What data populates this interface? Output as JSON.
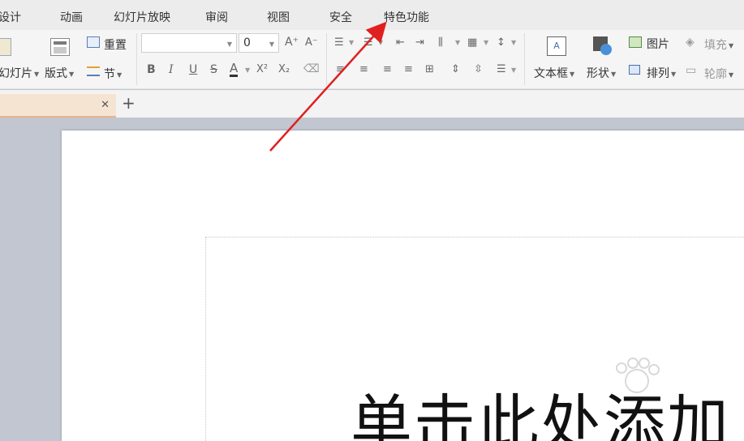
{
  "menubar": {
    "items": [
      "设计",
      "动画",
      "幻灯片放映",
      "审阅",
      "视图",
      "安全",
      "特色功能"
    ]
  },
  "ribbon": {
    "new_slide_label": "幻灯片",
    "layout_label": "版式",
    "reset_label": "重置",
    "section_label": "节",
    "font_name_value": "",
    "font_size_value": "0",
    "bold": "B",
    "italic": "I",
    "underline": "U",
    "strike": "S",
    "font_color": "A",
    "superscript": "X²",
    "subscript": "X₂",
    "grow_font": "A⁺",
    "shrink_font": "A⁻",
    "textbox_label": "文本框",
    "shape_label": "形状",
    "picture_label": "图片",
    "arrange_label": "排列",
    "fill_label": "填充",
    "outline_label": "轮廓"
  },
  "slide": {
    "placeholder_text": "单击此处添加"
  },
  "colors": {
    "accent_arrow": "#e02020",
    "tab_active": "#f6e4d3",
    "tab_underline": "#e8b38a"
  }
}
